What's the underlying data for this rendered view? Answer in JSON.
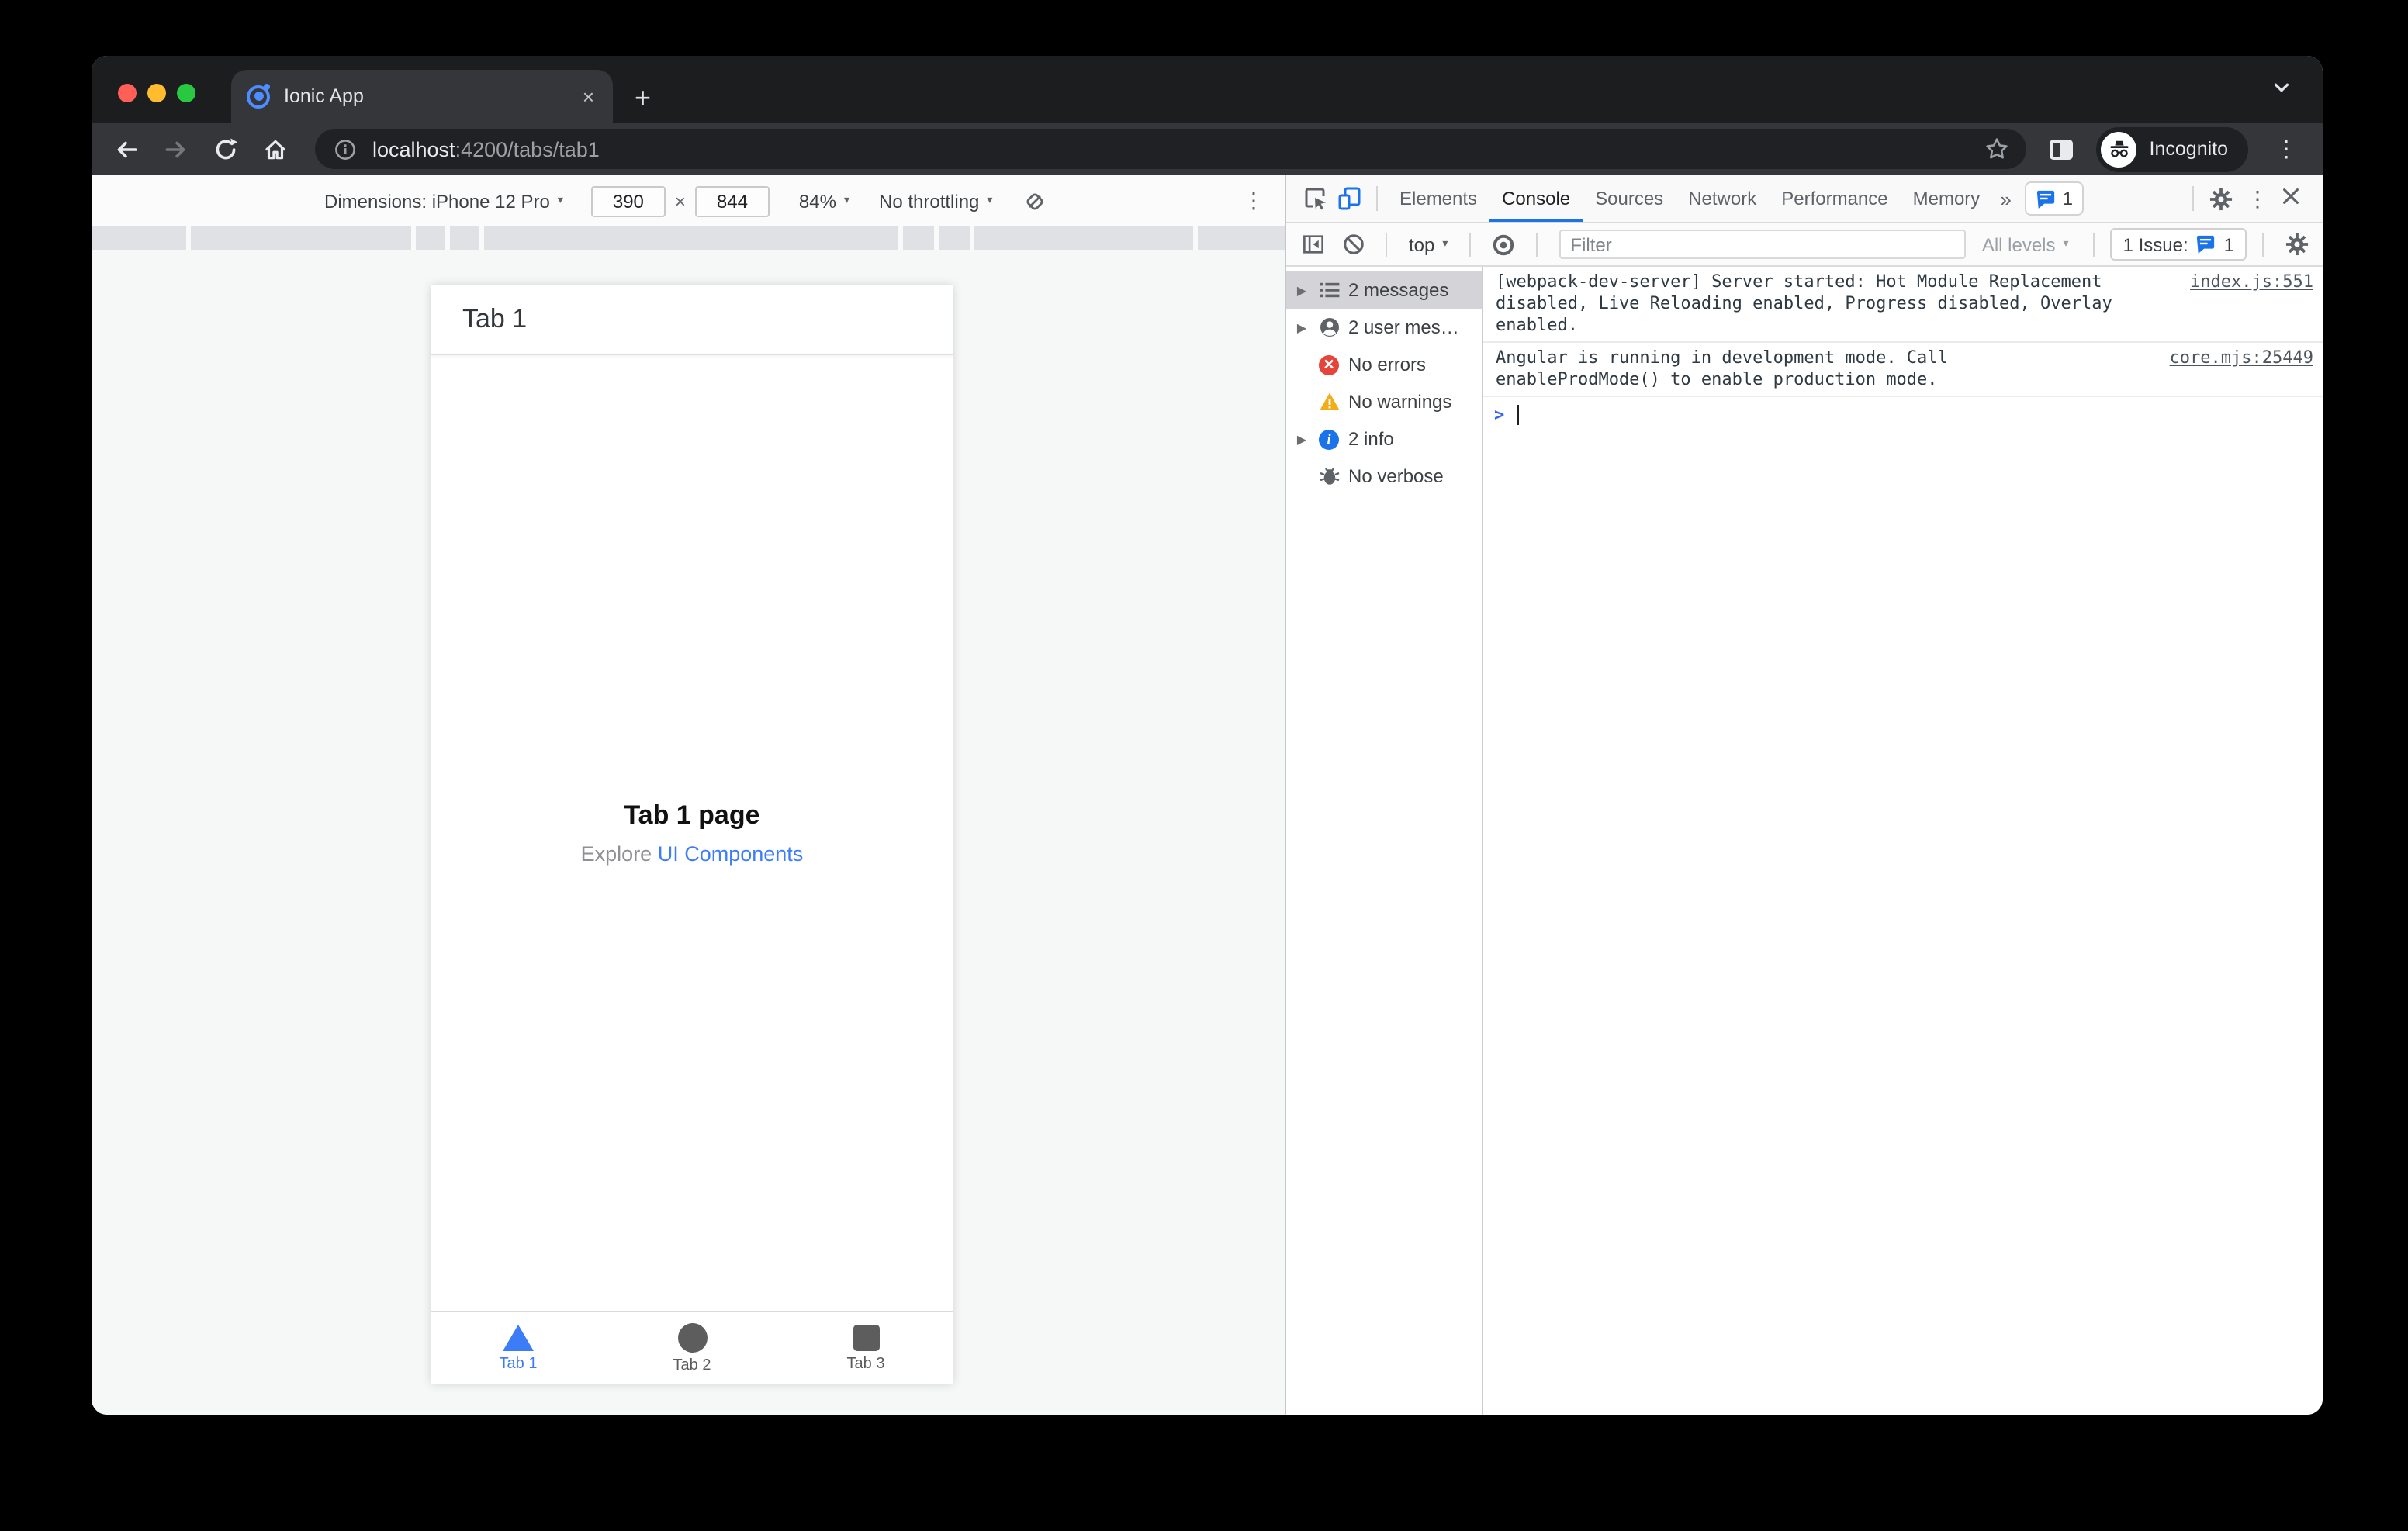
{
  "icons": {
    "close": "×",
    "plus": "+",
    "kebab": "⋮",
    "caret": "▾",
    "disclosure": "▶",
    "more_tabs": "»",
    "prompt": ">",
    "error_glyph": "✕",
    "info_glyph": "i",
    "times": "×"
  },
  "chrome": {
    "tab_title": "Ionic App",
    "url_host": "localhost",
    "url_rest": ":4200/tabs/tab1",
    "incognito_label": "Incognito"
  },
  "device_toolbar": {
    "dimensions_label": "Dimensions: iPhone 12 Pro",
    "width_value": "390",
    "height_value": "844",
    "zoom_value": "84%",
    "throttling_value": "No throttling"
  },
  "app": {
    "header_title": "Tab 1",
    "heading": "Tab 1 page",
    "explore_prefix": "Explore ",
    "explore_link": "UI Components",
    "tabs": [
      {
        "label": "Tab 1"
      },
      {
        "label": "Tab 2"
      },
      {
        "label": "Tab 3"
      }
    ]
  },
  "devtools": {
    "tabs": [
      {
        "label": "Elements"
      },
      {
        "label": "Console"
      },
      {
        "label": "Sources"
      },
      {
        "label": "Network"
      },
      {
        "label": "Performance"
      },
      {
        "label": "Memory"
      }
    ],
    "tabbar_issue_count": "1",
    "toolbar": {
      "context_selector": "top",
      "filter_placeholder": "Filter",
      "levels_label": "All levels",
      "issues_label": "1 Issue:",
      "issues_count": "1"
    },
    "sidebar_items": [
      {
        "label": "2 messages"
      },
      {
        "label": "2 user mes…"
      },
      {
        "label": "No errors"
      },
      {
        "label": "No warnings"
      },
      {
        "label": "2 info"
      },
      {
        "label": "No verbose"
      }
    ],
    "messages": [
      {
        "text": "[webpack-dev-server] Server started: Hot Module Replacement disabled, Live Reloading enabled, Progress disabled, Overlay enabled.",
        "source": "index.js:551"
      },
      {
        "text": "Angular is running in development mode. Call enableProdMode() to enable production mode.",
        "source": "core.mjs:25449"
      }
    ]
  },
  "colors": {
    "accent_blue": "#1a73e8",
    "ionic_blue": "#3d7cf7",
    "error_red": "#e5443b",
    "warning_yellow": "#f2ac18"
  }
}
